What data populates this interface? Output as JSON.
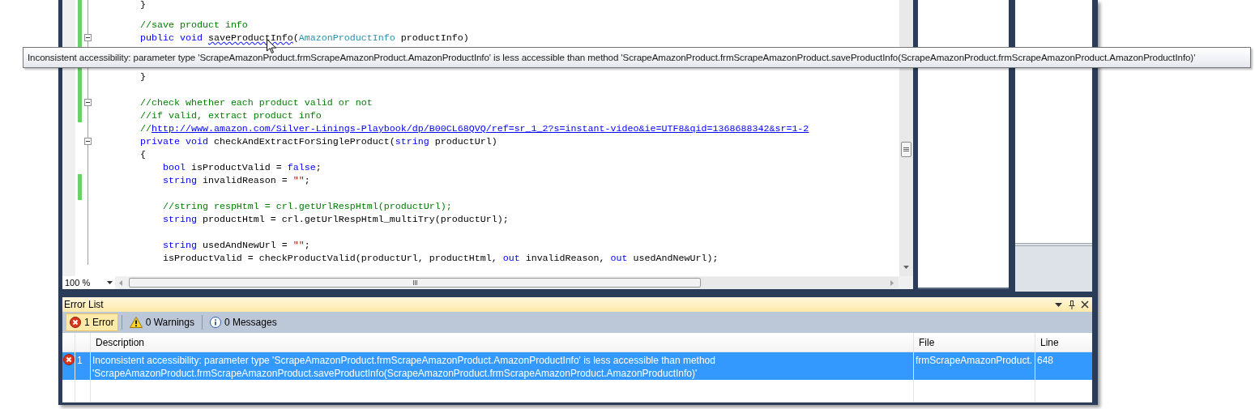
{
  "editor": {
    "lines": [
      {
        "changed": true,
        "collapsible": false,
        "tokens": [
          {
            "text": "        }",
            "kind": "plain"
          }
        ]
      },
      {
        "changed": true,
        "collapsible": false
      },
      {
        "changed": true,
        "collapsible": false,
        "tokens": [
          {
            "text": "        //save product info",
            "kind": "comment"
          }
        ]
      },
      {
        "changed": true,
        "collapsible": true,
        "tokens": [
          {
            "text": "        public void ",
            "kind": "keyword"
          },
          {
            "text": "saveProductInfo",
            "kind": "error"
          },
          {
            "text": "(",
            "kind": "plain"
          },
          {
            "text": "AmazonProductInfo",
            "kind": "type"
          },
          {
            "text": " productInfo)",
            "kind": "plain"
          }
        ]
      },
      {
        "changed": true,
        "collapsible": false
      },
      {
        "changed": true,
        "collapsible": false
      },
      {
        "changed": true,
        "collapsible": false,
        "tokens": [
          {
            "text": "        }",
            "kind": "plain"
          }
        ]
      },
      {
        "changed": true,
        "collapsible": false
      },
      {
        "changed": true,
        "collapsible": true,
        "tokens": [
          {
            "text": "        //check whether each product valid or not",
            "kind": "comment"
          }
        ]
      },
      {
        "changed": true,
        "collapsible": false,
        "tokens": [
          {
            "text": "        //if valid, extract product info",
            "kind": "comment"
          }
        ]
      },
      {
        "changed": false,
        "collapsible": false,
        "tokens": [
          {
            "text": "        //",
            "kind": "comment"
          },
          {
            "text": "http://www.amazon.com/Silver-Linings-Playbook/dp/B00CL68QVQ/ref=sr_1_2?s=instant-video&ie=UTF8&qid=1368688342&sr=1-2",
            "kind": "link"
          }
        ]
      },
      {
        "changed": false,
        "collapsible": true,
        "tokens": [
          {
            "text": "        private void ",
            "kind": "keyword"
          },
          {
            "text": "checkAndExtractForSingleProduct(",
            "kind": "plain"
          },
          {
            "text": "string",
            "kind": "keyword"
          },
          {
            "text": " productUrl)",
            "kind": "plain"
          }
        ]
      },
      {
        "changed": false,
        "collapsible": false,
        "tokens": [
          {
            "text": "        {",
            "kind": "plain"
          }
        ]
      },
      {
        "changed": false,
        "collapsible": false,
        "tokens": [
          {
            "text": "            bool",
            "kind": "keyword"
          },
          {
            "text": " isProductValid = ",
            "kind": "plain"
          },
          {
            "text": "false",
            "kind": "keyword"
          },
          {
            "text": ";",
            "kind": "plain"
          }
        ]
      },
      {
        "changed": true,
        "collapsible": false,
        "tokens": [
          {
            "text": "            string",
            "kind": "keyword"
          },
          {
            "text": " invalidReason = ",
            "kind": "plain"
          },
          {
            "text": "\"\"",
            "kind": "string"
          },
          {
            "text": ";",
            "kind": "plain"
          }
        ]
      },
      {
        "changed": true,
        "collapsible": false
      },
      {
        "changed": false,
        "collapsible": false,
        "tokens": [
          {
            "text": "            //string respHtml = crl.getUrlRespHtml(productUrl);",
            "kind": "comment"
          }
        ]
      },
      {
        "changed": false,
        "collapsible": false,
        "tokens": [
          {
            "text": "            string",
            "kind": "keyword"
          },
          {
            "text": " productHtml = crl.getUrlRespHtml_multiTry(productUrl);",
            "kind": "plain"
          }
        ]
      },
      {
        "changed": false,
        "collapsible": false
      },
      {
        "changed": false,
        "collapsible": false,
        "tokens": [
          {
            "text": "            string",
            "kind": "keyword"
          },
          {
            "text": " usedAndNewUrl = ",
            "kind": "plain"
          },
          {
            "text": "\"\"",
            "kind": "string"
          },
          {
            "text": ";",
            "kind": "plain"
          }
        ]
      },
      {
        "changed": false,
        "collapsible": false,
        "tokens": [
          {
            "text": "            isProductValid = checkProductValid(productUrl, productHtml, ",
            "kind": "plain"
          },
          {
            "text": "out",
            "kind": "keyword"
          },
          {
            "text": " invalidReason, ",
            "kind": "plain"
          },
          {
            "text": "out",
            "kind": "keyword"
          },
          {
            "text": " usedAndNewUrl);",
            "kind": "plain"
          }
        ]
      }
    ],
    "zoom": "100 %"
  },
  "tooltip": {
    "text": "Inconsistent accessibility: parameter type 'ScrapeAmazonProduct.frmScrapeAmazonProduct.AmazonProductInfo' is less accessible than method 'ScrapeAmazonProduct.frmScrapeAmazonProduct.saveProductInfo(ScrapeAmazonProduct.frmScrapeAmazonProduct.AmazonProductInfo)'"
  },
  "error_list": {
    "title": "Error List",
    "filters": [
      {
        "label": "1 Error",
        "kind": "error",
        "selected": true
      },
      {
        "label": "0 Warnings",
        "kind": "warning",
        "selected": false
      },
      {
        "label": "0 Messages",
        "kind": "message",
        "selected": false
      }
    ],
    "columns": [
      "Description",
      "File",
      "Line"
    ],
    "rows": [
      {
        "kind": "error",
        "number": "1",
        "description": "Inconsistent accessibility: parameter type 'ScrapeAmazonProduct.frmScrapeAmazonProduct.AmazonProductInfo' is less accessible than method 'ScrapeAmazonProduct.frmScrapeAmazonProduct.saveProductInfo(ScrapeAmazonProduct.frmScrapeAmazonProduct.AmazonProductInfo)'",
        "file": "frmScrapeAmazonProduct.",
        "line": "648",
        "selected": true
      }
    ]
  }
}
